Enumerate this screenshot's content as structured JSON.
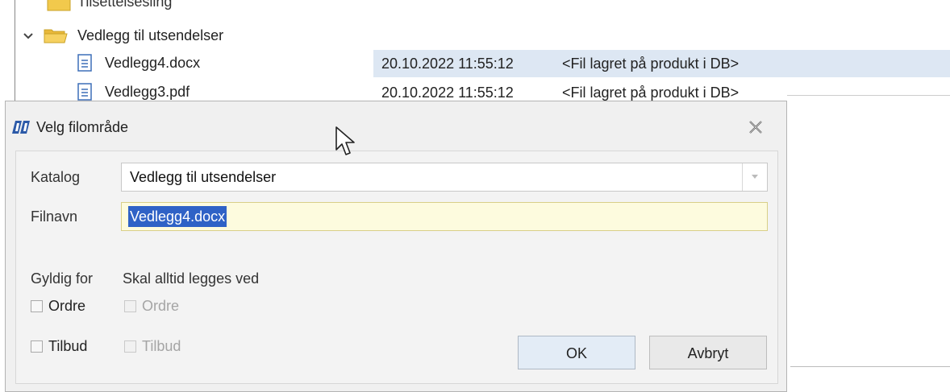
{
  "tree": {
    "partial_item": "Tilsettelsesling",
    "folder": {
      "label": "Vedlegg til utsendelser"
    },
    "files": [
      {
        "name": "Vedlegg4.docx",
        "timestamp": "20.10.2022 11:55:12",
        "location": "<Fil lagret på produkt i DB>"
      },
      {
        "name": "Vedlegg3.pdf",
        "timestamp": "20.10.2022 11:55:12",
        "location": "<Fil lagret på produkt i DB>"
      }
    ]
  },
  "dialog": {
    "title": "Velg filområde",
    "katalog_label": "Katalog",
    "katalog_value": "Vedlegg til utsendelser",
    "filnavn_label": "Filnavn",
    "filnavn_value": "Vedlegg4.docx",
    "gyldig_label": "Gyldig for",
    "skal_label": "Skal alltid legges ved",
    "gyldig_options": [
      {
        "label": "Ordre",
        "checked": false,
        "enabled": true
      },
      {
        "label": "Tilbud",
        "checked": false,
        "enabled": true
      }
    ],
    "skal_options": [
      {
        "label": "Ordre",
        "checked": false,
        "enabled": false
      },
      {
        "label": "Tilbud",
        "checked": false,
        "enabled": false
      }
    ],
    "ok_label": "OK",
    "cancel_label": "Avbryt"
  },
  "colors": {
    "selection": "#2f62c6",
    "row_highlight": "#dde7f3",
    "input_bg": "#fdfbde",
    "folder": "#f2c94c"
  }
}
